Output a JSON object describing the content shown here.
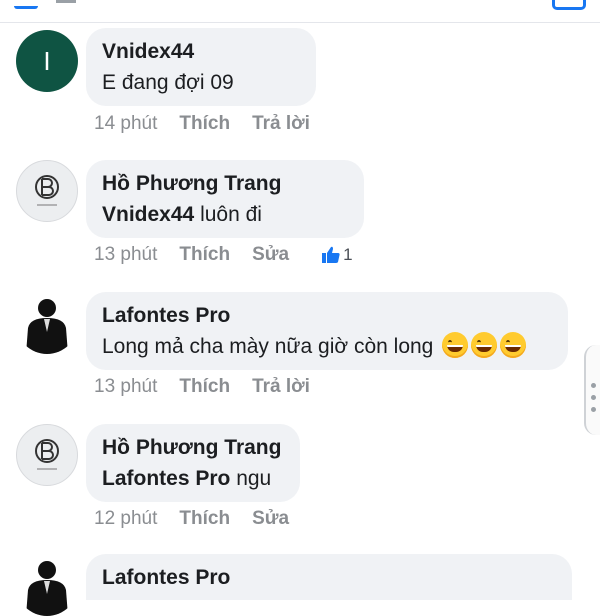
{
  "comments": [
    {
      "avatar": {
        "type": "letter",
        "letter": "I",
        "color": "#0f5443"
      },
      "author": "Vnidex44",
      "mention": "",
      "text": "E đang đợi 09",
      "emoji": [],
      "time": "14 phút",
      "like_label": "Thích",
      "second_action": "Trả lời",
      "likes": ""
    },
    {
      "avatar": {
        "type": "logo"
      },
      "author": "Hồ Phương Trang",
      "mention": "Vnidex44",
      "text": "luôn đi",
      "emoji": [],
      "time": "13 phút",
      "like_label": "Thích",
      "second_action": "Sửa",
      "likes": "1"
    },
    {
      "avatar": {
        "type": "photo"
      },
      "author": "Lafontes Pro",
      "mention": "",
      "text": "Long mả cha mày nữa giờ còn long",
      "emoji": [
        "grinning-face",
        "grinning-face",
        "grinning-face"
      ],
      "time": "13 phút",
      "like_label": "Thích",
      "second_action": "Trả lời",
      "likes": ""
    },
    {
      "avatar": {
        "type": "logo"
      },
      "author": "Hồ Phương Trang",
      "mention": "Lafontes Pro",
      "text": "ngu",
      "emoji": [],
      "time": "12 phút",
      "like_label": "Thích",
      "second_action": "Sửa",
      "likes": ""
    },
    {
      "avatar": {
        "type": "photo"
      },
      "author": "Lafontes Pro",
      "mention": "",
      "text": "",
      "emoji": [],
      "time": "",
      "like_label": "",
      "second_action": "",
      "likes": ""
    }
  ],
  "colors": {
    "bubble": "#f0f2f5",
    "action_text": "#8a8d91",
    "like_blue": "#1877f2"
  }
}
